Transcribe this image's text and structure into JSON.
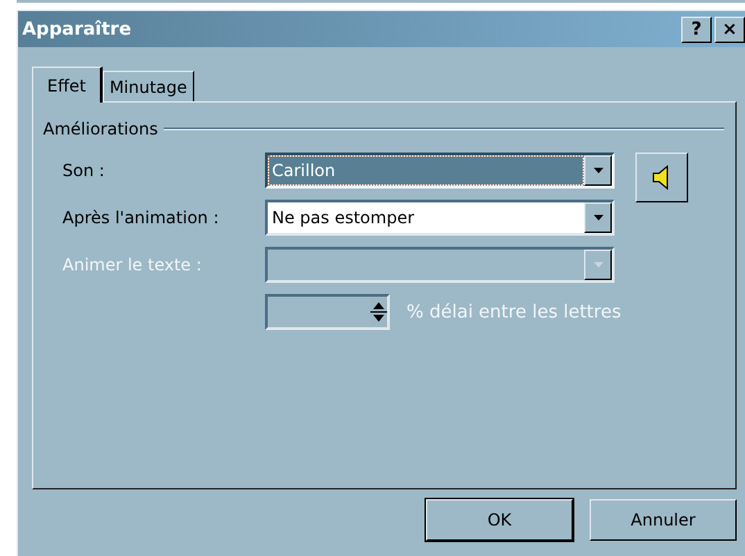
{
  "window": {
    "title": "Apparaître",
    "help_button": "?",
    "close_button": "×"
  },
  "tabs": [
    {
      "label": "Effet",
      "selected": true
    },
    {
      "label": "Minutage",
      "selected": false
    }
  ],
  "group": {
    "title": "Améliorations",
    "rows": [
      {
        "kind": "sound_combo",
        "label": "Son :",
        "value": "Carillon",
        "disabled": false,
        "focused": true
      },
      {
        "kind": "combo",
        "label": "Après l'animation :",
        "value": "Ne pas estomper",
        "disabled": false,
        "focused": false
      },
      {
        "kind": "combo",
        "label": "Animer le texte :",
        "disabled": true,
        "focused": false
      },
      {
        "kind": "spin",
        "suffix": "% délai entre les lettres",
        "disabled": true
      }
    ]
  },
  "buttons": [
    {
      "label": "OK",
      "default": true
    },
    {
      "label": "Annuler",
      "default": false
    }
  ]
}
